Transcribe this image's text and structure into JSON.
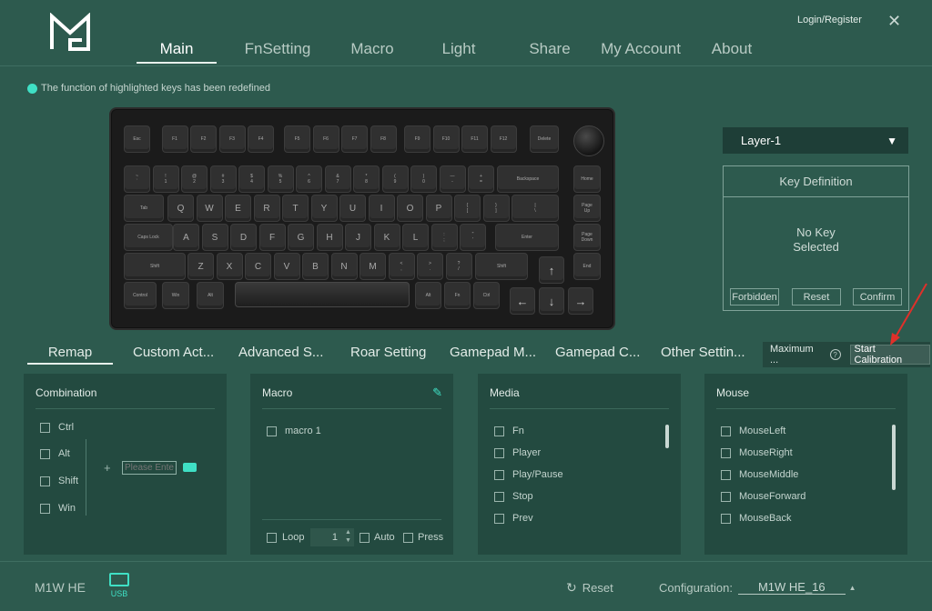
{
  "header": {
    "login": "Login/Register",
    "nav": [
      "Main",
      "FnSetting",
      "Macro",
      "Light",
      "Share",
      "My Account",
      "About"
    ],
    "active_nav": "Main"
  },
  "notice": "The function of highlighted keys has been redefined",
  "keyboard": {
    "row0": [
      "Esc",
      "F1",
      "F2",
      "F3",
      "F4",
      "F5",
      "F6",
      "F7",
      "F8",
      "F9",
      "F10",
      "F11",
      "F12",
      "Delete"
    ],
    "row1": [
      "~\n`",
      "!\n1",
      "@\n2",
      "#\n3",
      "$\n4",
      "%\n5",
      "^\n6",
      "&\n7",
      "*\n8",
      "(\n9",
      ")\n0",
      "—\n-",
      "+\n=",
      "Backspace",
      "Home"
    ],
    "row2": [
      "Tab",
      "Q",
      "W",
      "E",
      "R",
      "T",
      "Y",
      "U",
      "I",
      "O",
      "P",
      "{\n[",
      "}\n]",
      "|\n\\",
      "Page\nUp"
    ],
    "row3": [
      "Caps Lock",
      "A",
      "S",
      "D",
      "F",
      "G",
      "H",
      "J",
      "K",
      "L",
      ":\n;",
      "\"\n'",
      "Enter",
      "Page\nDown"
    ],
    "row4": [
      "Shift",
      "Z",
      "X",
      "C",
      "V",
      "B",
      "N",
      "M",
      "<\n,",
      ">\n.",
      "?\n/",
      "Shift",
      "↑",
      "End"
    ],
    "row5": [
      "Control",
      "Win",
      "Alt",
      "Alt",
      "Fn",
      "Ctrl",
      "←",
      "↓",
      "→"
    ]
  },
  "layer": {
    "value": "Layer-1"
  },
  "key_definition": {
    "title": "Key Definition",
    "empty_line1": "No Key",
    "empty_line2": "Selected",
    "buttons": [
      "Forbidden",
      "Reset",
      "Confirm"
    ]
  },
  "subtabs": [
    "Remap",
    "Custom Act...",
    "Advanced S...",
    "Roar Setting",
    "Gamepad M...",
    "Gamepad C...",
    "Other Settin..."
  ],
  "calibration": {
    "label": "Maximum ...",
    "button": "Start Calibration"
  },
  "panels": {
    "combination": {
      "title": "Combination",
      "modifiers": [
        "Ctrl",
        "Alt",
        "Shift",
        "Win"
      ],
      "plus": "+",
      "placeholder": "Please Enter"
    },
    "macro": {
      "title": "Macro",
      "items": [
        "macro 1"
      ],
      "loop_label": "Loop",
      "loop_count": "1",
      "auto_label": "Auto",
      "press_label": "Press"
    },
    "media": {
      "title": "Media",
      "items": [
        "Fn",
        "Player",
        "Play/Pause",
        "Stop",
        "Prev"
      ]
    },
    "mouse": {
      "title": "Mouse",
      "items": [
        "MouseLeft",
        "MouseRight",
        "MouseMiddle",
        "MouseForward",
        "MouseBack"
      ]
    }
  },
  "footer": {
    "device": "M1W HE",
    "usb": "USB",
    "reset": "Reset",
    "config_label": "Configuration:",
    "config_value": "M1W HE_16"
  },
  "colors": {
    "background": "#2d5a4e",
    "panel": "#234a40",
    "accent": "#3fe0c5",
    "arrow": "#e0302a"
  }
}
